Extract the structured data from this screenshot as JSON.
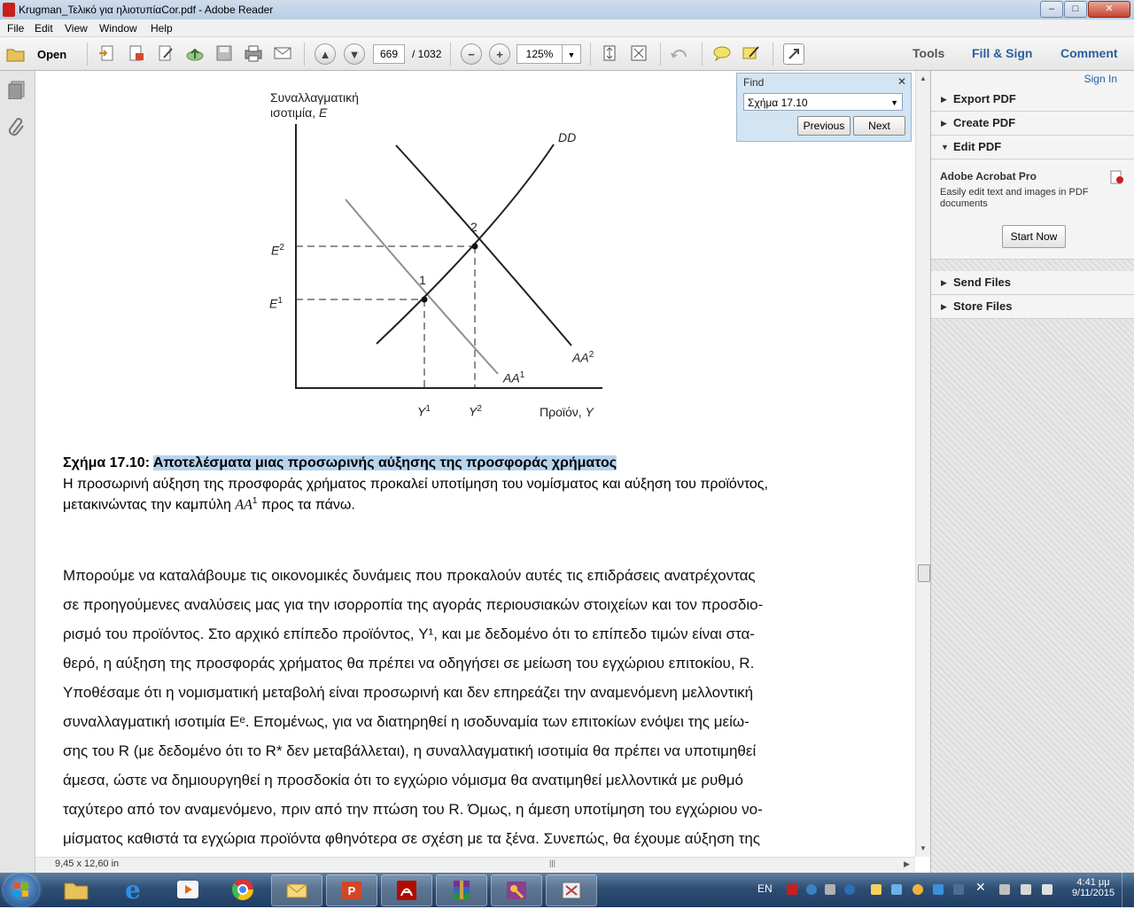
{
  "window": {
    "title": "Krugman_Τελικό για ηλιοτυπίαCor.pdf - Adobe Reader",
    "buttons": {
      "minimize": "–",
      "maximize": "□",
      "close": "✕"
    }
  },
  "menubar": {
    "items": [
      "File",
      "Edit",
      "View",
      "Window",
      "Help"
    ]
  },
  "toolbar": {
    "open_label": "Open",
    "page_current": "669",
    "page_total": "/ 1032",
    "zoom_value": "125%",
    "tools_label": "Tools",
    "fill_sign_label": "Fill & Sign",
    "comment_label": "Comment"
  },
  "find": {
    "title": "Find",
    "query": "Σχήμα 17.10",
    "previous_label": "Previous",
    "next_label": "Next"
  },
  "right_panel": {
    "sign_in": "Sign In",
    "sections": [
      {
        "label": "Export PDF",
        "state": "collapsed"
      },
      {
        "label": "Create PDF",
        "state": "collapsed"
      },
      {
        "label": "Edit PDF",
        "state": "expanded"
      }
    ],
    "edit_pdf": {
      "product": "Adobe Acrobat Pro",
      "description_line1": "Easily edit text and images in PDF",
      "description_line2": "documents",
      "button": "Start Now"
    },
    "bottom_sections": [
      {
        "label": "Send Files"
      },
      {
        "label": "Store Files"
      }
    ]
  },
  "figure": {
    "y_axis_line1": "Συναλλαγματική",
    "y_axis_line2": "ισοτιμία, ",
    "y_axis_var": "E",
    "x_axis_label": "Προϊόν, ",
    "x_axis_var": "Y",
    "curve_dd": "DD",
    "curve_aa1": "AA",
    "curve_aa1_sup": "1",
    "curve_aa2": "AA",
    "curve_aa2_sup": "2",
    "point1": "1",
    "point2": "2",
    "e1": "E",
    "e1_sup": "1",
    "e2": "E",
    "e2_sup": "2",
    "y1": "Y",
    "y1_sup": "1",
    "y2": "Y",
    "y2_sup": "2"
  },
  "document": {
    "caption_prefix": "Σχήμα 17.10: ",
    "caption_highlight": "Αποτελέσματα μιας προσωρινής αύξησης της προσφοράς χρήματος",
    "caption_line2": "Η προσωρινή αύξηση της προσφοράς χρήματος προκαλεί υποτίμηση του νομίσματος και αύξηση του προϊόντος,",
    "caption_line3_a": "μετακινώντας την καμπύλη ",
    "caption_line3_var": "AA",
    "caption_line3_sup": "1",
    "caption_line3_b": " προς τα πάνω.",
    "lines": [
      "Μπορούμε να καταλάβουμε τις οικονομικές δυνάμεις που προκαλούν αυτές τις επιδράσεις ανατρέχοντας",
      "σε προηγούμενες αναλύσεις μας για την ισορροπία της αγοράς περιουσιακών στοιχείων και τον προσδιο-",
      "ρισμό του προϊόντος. Στο αρχικό επίπεδο προϊόντος, Y¹, και με δεδομένο ότι το επίπεδο τιμών είναι στα-",
      "θερό, η αύξηση της προσφοράς χρήματος θα πρέπει να οδηγήσει σε μείωση του εγχώριου επιτοκίου, R.",
      "Υποθέσαμε ότι η νομισματική μεταβολή είναι προσωρινή και δεν επηρεάζει την αναμενόμενη μελλοντική",
      "συναλλαγματική ισοτιμία Eᵉ. Επομένως, για να διατηρηθεί η ισοδυναμία των επιτοκίων ενόψει της μείω-",
      "σης του R (με δεδομένο ότι το R* δεν μεταβάλλεται), η συναλλαγματική ισοτιμία θα πρέπει να υποτιμηθεί",
      "άμεσα, ώστε να δημιουργηθεί η προσδοκία ότι το εγχώριο νόμισμα θα ανατιμηθεί μελλοντικά με ρυθμό",
      "ταχύτερο από τον αναμενόμενο, πριν από την πτώση του R. Όμως, η άμεση υποτίμηση του εγχώριου νο-",
      "μίσματος καθιστά τα εγχώρια προϊόντα φθηνότερα σε σχέση με τα ξένα. Συνεπώς, θα έχουμε αύξηση της"
    ]
  },
  "statusbar": {
    "page_size": "9,45 x 12,60 in"
  },
  "taskbar": {
    "language": "EN",
    "time": "4:41 μμ",
    "date": "9/11/2015"
  },
  "colors": {
    "highlight": "#b6d4ee",
    "find_bg": "#d3e5f3",
    "taskbar": "#2e4f74"
  }
}
